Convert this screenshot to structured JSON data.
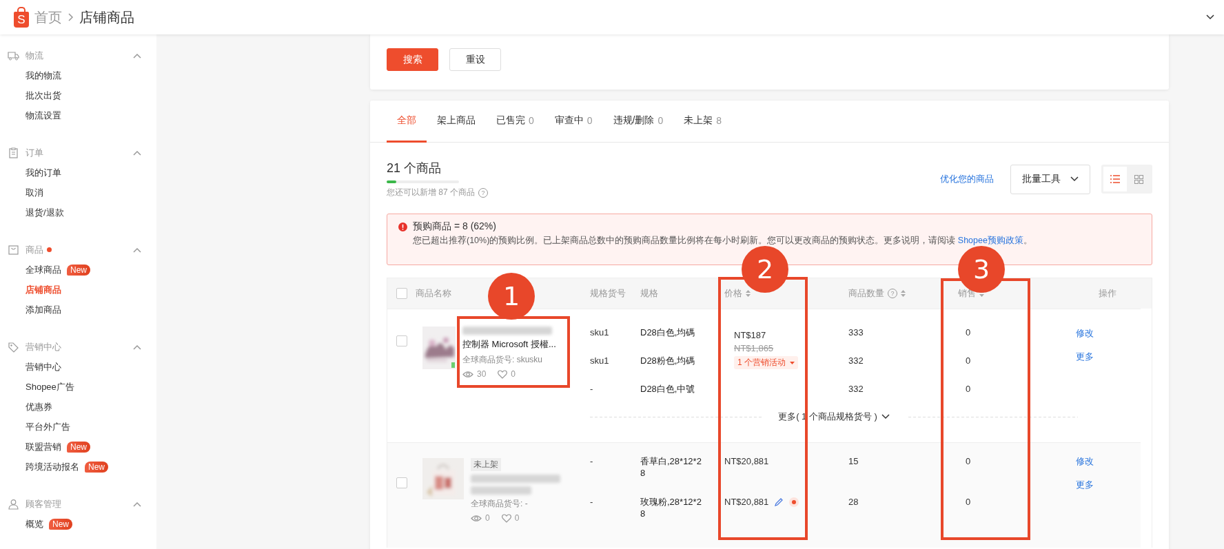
{
  "header": {
    "logo_letter": "S",
    "home": "首页",
    "current": "店铺商品"
  },
  "sidebar": [
    {
      "title": "物流",
      "expanded": true,
      "dot": false,
      "items": [
        {
          "label": "我的物流",
          "selected": false
        },
        {
          "label": "批次出货",
          "selected": false
        },
        {
          "label": "物流设置",
          "selected": false
        }
      ]
    },
    {
      "title": "订单",
      "expanded": true,
      "dot": false,
      "items": [
        {
          "label": "我的订单",
          "selected": false
        },
        {
          "label": "取消",
          "selected": false
        },
        {
          "label": "退货/退款",
          "selected": false
        }
      ]
    },
    {
      "title": "商品",
      "expanded": true,
      "dot": true,
      "items": [
        {
          "label": "全球商品",
          "badge": "New",
          "selected": false
        },
        {
          "label": "店铺商品",
          "selected": true
        },
        {
          "label": "添加商品",
          "selected": false
        }
      ]
    },
    {
      "title": "营销中心",
      "expanded": true,
      "dot": false,
      "items": [
        {
          "label": "营销中心",
          "selected": false
        },
        {
          "label": "Shopee广告",
          "selected": false
        },
        {
          "label": "优惠券",
          "selected": false
        },
        {
          "label": "平台外广告",
          "selected": false
        },
        {
          "label": "联盟营销",
          "badge": "New",
          "selected": false
        },
        {
          "label": "跨境活动报名",
          "badge": "New",
          "selected": false
        }
      ]
    },
    {
      "title": "顾客管理",
      "expanded": true,
      "dot": false,
      "items": [
        {
          "label": "概览",
          "badge": "New",
          "selected": false
        }
      ]
    }
  ],
  "filter": {
    "buttons": [
      {
        "label": "搜索",
        "kind": "primary"
      },
      {
        "label": "重设",
        "kind": "default"
      }
    ]
  },
  "tabs": [
    {
      "label": "全部",
      "selected": true
    },
    {
      "label": "架上商品",
      "selected": false
    },
    {
      "label": "已售完",
      "count": "0",
      "selected": false
    },
    {
      "label": "审查中",
      "count": "0",
      "selected": false
    },
    {
      "label": "违规/删除",
      "count": "0",
      "selected": false
    },
    {
      "label": "未上架",
      "count": "8",
      "selected": false
    }
  ],
  "summary": {
    "title": "21 个商品",
    "level": 0.13,
    "hint": "您还可以新增 87 个商品",
    "help": "?"
  },
  "toolbar": {
    "optimize_link": "优化您的商品",
    "bulk_tools": "批量工具",
    "view_modes": [
      {
        "kind": "list",
        "selected": true
      },
      {
        "kind": "grid",
        "selected": false
      }
    ]
  },
  "alert": {
    "title": "预购商品 = 8 (62%)",
    "message": "您已超出推荐(10%)的预购比例。已上架商品总数中的预购商品数量比例将在每小时刷新。您可以更改商品的预购状态。更多说明，请阅读",
    "link": "Shopee预购政策",
    "end": "。"
  },
  "table": {
    "select_all": {
      "checked": false
    },
    "columns": [
      {
        "label": "商品名称",
        "sortable": false
      },
      {
        "label": "规格货号",
        "sortable": false
      },
      {
        "label": "规格",
        "sortable": false
      },
      {
        "label": "价格",
        "sortable": true
      },
      {
        "label": "商品数量",
        "sortable": true,
        "help": "?"
      },
      {
        "label": "销售",
        "sortable": true
      },
      {
        "label": "操作",
        "sortable": false
      }
    ],
    "rows": [
      {
        "checked": false,
        "name": "控制器 Microsoft 授權...",
        "sku_label": "全球商品货号: skusku",
        "views": "30",
        "likes": "0",
        "variations": [
          {
            "sku": "sku1",
            "spec": "D28白色,均碼",
            "price": "NT$187",
            "original_price": "NT$1,865",
            "promo": "1 个营销活动",
            "quantity": "333",
            "sales": "0"
          },
          {
            "sku": "sku1",
            "spec": "D28粉色,均碼",
            "quantity": "332",
            "sales": "0"
          },
          {
            "sku": "-",
            "spec": "D28白色,中號",
            "quantity": "332",
            "sales": "0"
          }
        ],
        "more": "更多( 1 个商品规格货号 )",
        "actions": [
          "修改",
          "更多"
        ]
      },
      {
        "checked": false,
        "status_tag": "未上架",
        "sku_label": "全球商品货号: -",
        "views": "0",
        "likes": "0",
        "variations": [
          {
            "sku": "-",
            "spec": "香草白,28*12*28",
            "price": "NT$20,881",
            "editable": false,
            "quantity": "15",
            "sales": "0"
          },
          {
            "sku": "-",
            "spec": "玫瑰粉,28*12*28",
            "price": "NT$20,881",
            "editable": true,
            "quantity": "28",
            "sales": "0"
          }
        ],
        "actions": [
          "修改",
          "更多"
        ]
      }
    ]
  },
  "annotations": [
    {
      "number": "1"
    },
    {
      "number": "2"
    },
    {
      "number": "3"
    }
  ]
}
